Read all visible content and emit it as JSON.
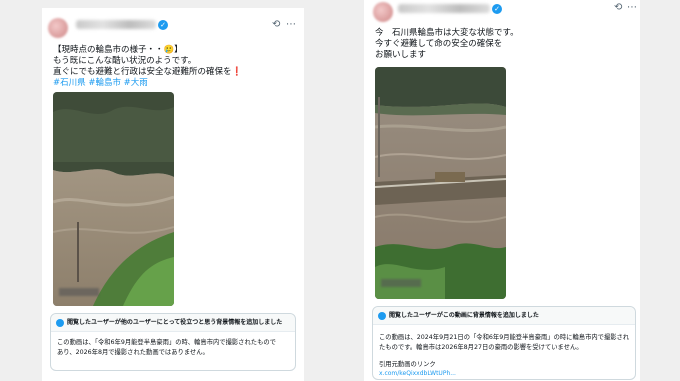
{
  "left_post": {
    "text_lines": [
      "【現時点の輪島市の様子・・🥲】",
      "もう既にこんな酷い状況のようです。",
      "直ぐにでも避難と行政は安全な避難所の確保を"
    ],
    "red_mark": "❗",
    "hashtags": "#石川県 #輪島市 #大雨",
    "note_header": "閲覧したユーザーが他のユーザーにとって役立つと思う背景情報を追加しました",
    "note_body": "この動画は、「令和6年9月能登半島豪雨」の時、輪島市内で撮影されたもので\nあり、2026年8月で撮影された動画ではありません。"
  },
  "right_post": {
    "text_lines": [
      "今　石川県輪島市は大変な状態です。",
      "今すぐ避難して命の安全の確保を",
      "お願いします"
    ],
    "note_header": "閲覧したユーザーがこの動画に背景情報を追加しました",
    "note_body": "この動画は、2024年9月21日の「令和6年9月能登半島豪雨」の時に輪島市内で撮影され\nたものです。輪島市は2026年8月27日の豪雨の影響を受けていません。",
    "source_label": "引用元動画のリンク",
    "source_link": "x.com/keQixxdbLWtUPh..."
  },
  "icons": [
    "verified-icon",
    "grok-icon",
    "more-icon"
  ],
  "colors": {
    "link": "#1d9bf0",
    "verified": "#1d9bf0",
    "background": "#efefef"
  }
}
